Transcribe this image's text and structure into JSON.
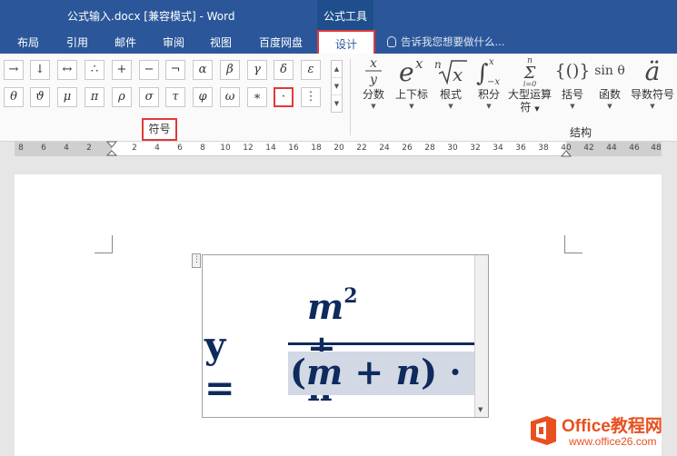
{
  "window": {
    "title": "公式输入.docx [兼容模式] - Word",
    "contextual_tab_group": "公式工具"
  },
  "tabs": [
    {
      "label": "布局"
    },
    {
      "label": "引用"
    },
    {
      "label": "邮件"
    },
    {
      "label": "审阅"
    },
    {
      "label": "视图"
    },
    {
      "label": "百度网盘"
    },
    {
      "label": "设计"
    }
  ],
  "tell_me": {
    "placeholder": "告诉我您想要做什么..."
  },
  "symbols": {
    "row1": [
      "→",
      "↓",
      "↔",
      "∴",
      "+",
      "−",
      "¬",
      "α",
      "β",
      "γ",
      "δ",
      "ε"
    ],
    "row2": [
      "θ",
      "ϑ",
      "μ",
      "π",
      "ρ",
      "σ",
      "τ",
      "φ",
      "ω",
      "∗",
      "·",
      "⋮"
    ],
    "group_label": "符号",
    "selected": "·"
  },
  "structures": {
    "items": [
      {
        "label": "分数",
        "icon": "fraction-icon"
      },
      {
        "label": "上下标",
        "icon": "script-icon"
      },
      {
        "label": "根式",
        "icon": "radical-icon"
      },
      {
        "label": "积分",
        "icon": "integral-icon"
      },
      {
        "label": "大型运算符",
        "icon": "large-operator-icon"
      },
      {
        "label": "括号",
        "icon": "bracket-icon"
      },
      {
        "label": "函数",
        "icon": "function-icon"
      },
      {
        "label": "导数符号",
        "icon": "accent-icon"
      }
    ],
    "group_label": "结构"
  },
  "ruler": {
    "ticks": [
      "8",
      "6",
      "4",
      "2",
      "2",
      "4",
      "6",
      "8",
      "10",
      "12",
      "14",
      "16",
      "18",
      "20",
      "22",
      "24",
      "26",
      "28",
      "30",
      "32",
      "34",
      "36",
      "38",
      "40",
      "42",
      "44",
      "46",
      "48"
    ]
  },
  "equation": {
    "lhs": "y =",
    "numerator_var": "m",
    "numerator_exp": "2",
    "numerator_rest": " + n",
    "denominator_open": "(",
    "denominator_var1": "m",
    "denominator_plus": " + ",
    "denominator_var2": "n",
    "denominator_close": ") ·"
  },
  "watermark": {
    "brand": "Office教程网",
    "url": "www.office26.com"
  },
  "colors": {
    "accent": "#2b579a",
    "highlight": "#e03a3a",
    "equation": "#0f2a5c",
    "watermark": "#e8501f"
  }
}
